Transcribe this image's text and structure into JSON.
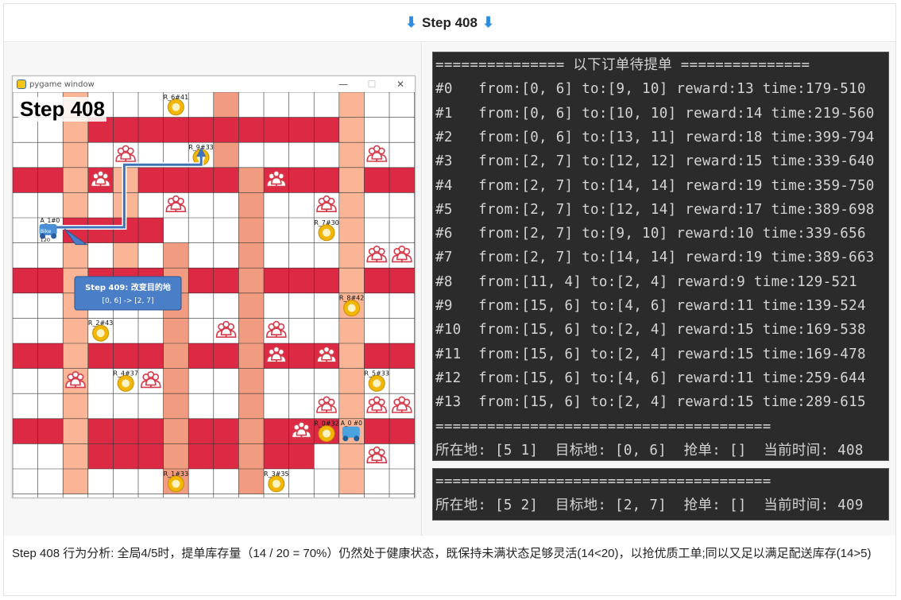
{
  "header": {
    "arrow_left": "⬇",
    "title": "Step 408",
    "arrow_right": "⬇"
  },
  "pygame": {
    "window_title": "pygame window",
    "minimize": "—",
    "maximize": "☐",
    "close": "✕",
    "step_label": "Step 408",
    "tooltip_title": "Step 409: 改变目的地",
    "tooltip_sub": "[0, 6] -> [2, 7]",
    "agent_label": "A_1#0",
    "agent_sub1": "Bike",
    "agent_sub2": "120",
    "rider_label": "A_0 #0",
    "restaurants": [
      {
        "label": "R_6#41",
        "col": 6,
        "row": 0
      },
      {
        "label": "R_9#33",
        "col": 7,
        "row": 2
      },
      {
        "label": "R_7#30",
        "col": 12,
        "row": 5
      },
      {
        "label": "R_8#42",
        "col": 13,
        "row": 8
      },
      {
        "label": "R_2#43",
        "col": 3,
        "row": 9
      },
      {
        "label": "R_4#37",
        "col": 4,
        "row": 11
      },
      {
        "label": "R_5#33",
        "col": 14,
        "row": 11
      },
      {
        "label": "R_0#32",
        "col": 12,
        "row": 13
      },
      {
        "label": "R_1#33",
        "col": 6,
        "row": 15
      },
      {
        "label": "R_3#35",
        "col": 10,
        "row": 15
      }
    ]
  },
  "terminal1": {
    "lines": [
      "=============== 以下订单待提单 ===============",
      "#0   from:[0, 6] to:[9, 10] reward:13 time:179-510",
      "#1   from:[0, 6] to:[10, 10] reward:14 time:219-560",
      "#2   from:[0, 6] to:[13, 11] reward:18 time:399-794",
      "#3   from:[2, 7] to:[12, 12] reward:15 time:339-640",
      "#4   from:[2, 7] to:[14, 14] reward:19 time:359-750",
      "#5   from:[2, 7] to:[12, 14] reward:17 time:389-698",
      "#6   from:[2, 7] to:[9, 10] reward:10 time:339-656",
      "#7   from:[2, 7] to:[14, 14] reward:19 time:389-663",
      "#8   from:[11, 4] to:[2, 4] reward:9 time:129-521",
      "#9   from:[15, 6] to:[4, 6] reward:11 time:139-524",
      "#10  from:[15, 6] to:[2, 4] reward:15 time:169-538",
      "#11  from:[15, 6] to:[2, 4] reward:15 time:169-478",
      "#12  from:[15, 6] to:[4, 6] reward:11 time:259-644",
      "#13  from:[15, 6] to:[2, 4] reward:15 time:289-615",
      "=======================================",
      "所在地: [5 1]  目标地: [0, 6]  抢单: []  当前时间: 408"
    ]
  },
  "terminal2": {
    "lines": [
      "=======================================",
      "所在地: [5 2]  目标地: [2, 7]  抢单: []  当前时间: 409"
    ]
  },
  "footer": {
    "text": "Step 408 行为分析:  全局4/5时，提单库存量（14 / 20 = 70%）仍然处于健康状态，既保持未满状态足够灵活(14<20)，以抢优质工单;同以又足以满足配送库存(14>5)"
  },
  "colors": {
    "dark_road": "#dc2a45",
    "salmon": "#f19c80",
    "light_salmon": "#f9b596",
    "customer": "#d63a4a",
    "restaurant": "#f2b705",
    "route": "#3f72b8",
    "terminal_bg": "#2b2b2b"
  }
}
